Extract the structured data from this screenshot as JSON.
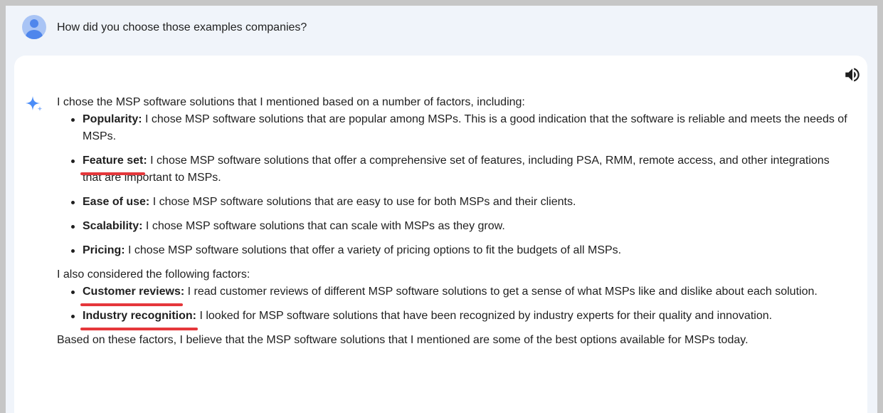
{
  "prompt": {
    "text": "How did you choose those examples companies?"
  },
  "response": {
    "intro": "I chose the MSP software solutions that I mentioned based on a number of factors, including:",
    "factors": [
      {
        "term": "Popularity:",
        "text": " I chose MSP software solutions that are popular among MSPs. This is a good indication that the software is reliable and meets the needs of MSPs."
      },
      {
        "term": "Feature set:",
        "text": " I chose MSP software solutions that offer a comprehensive set of features, including PSA, RMM, remote access, and other integrations that are important to MSPs."
      },
      {
        "term": "Ease of use:",
        "text": " I chose MSP software solutions that are easy to use for both MSPs and their clients."
      },
      {
        "term": "Scalability:",
        "text": " I chose MSP software solutions that can scale with MSPs as they grow."
      },
      {
        "term": "Pricing:",
        "text": " I chose MSP software solutions that offer a variety of pricing options to fit the budgets of all MSPs."
      }
    ],
    "middle": "I also considered the following factors:",
    "other_factors": [
      {
        "term": "Customer reviews:",
        "text": " I read customer reviews of different MSP software solutions to get a sense of what MSPs like and dislike about each solution."
      },
      {
        "term": "Industry recognition:",
        "text": " I looked for MSP software solutions that have been recognized by industry experts for their quality and innovation."
      }
    ],
    "outro": "Based on these factors, I believe that the MSP software solutions that I mentioned are some of the best options available for MSPs today."
  },
  "icons": {
    "avatar": "user-avatar-icon",
    "speaker": "volume-icon",
    "sparkle": "gemini-sparkle-icon"
  },
  "colors": {
    "background": "#f0f4fa",
    "card": "#ffffff",
    "highlight_underline": "#e5373b",
    "sparkle": "#4b8df8"
  }
}
